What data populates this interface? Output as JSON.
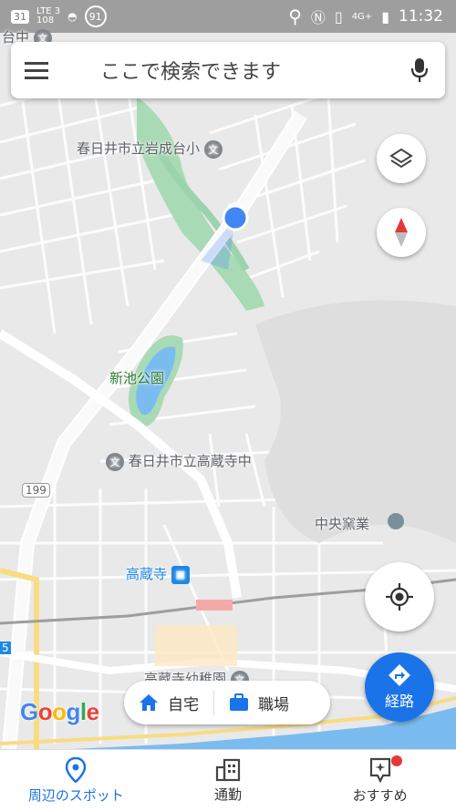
{
  "status_bar": {
    "calendar_day": "31",
    "network": "LTE 3",
    "network_sub": "108",
    "circle_badge": "91",
    "signal": "4G+",
    "time": "11:32"
  },
  "search": {
    "placeholder": "ここで検索できます"
  },
  "map": {
    "labels": {
      "top_fragment": "台中",
      "school_iwanari": "春日井市立岩成台小",
      "park": "新池公園",
      "school_kozoji": "春日井市立高蔵寺中",
      "route_number": "199",
      "company": "中央窯業",
      "station": "高蔵寺",
      "kindergarten": "高蔵寺幼稚園",
      "left_fragment": "5"
    },
    "school_icon_glyph": "文"
  },
  "chips": {
    "home": "自宅",
    "work": "職場"
  },
  "directions_label": "経路",
  "google_logo": {
    "letters": [
      "G",
      "o",
      "o",
      "g",
      "l",
      "e"
    ],
    "colors": [
      "#4285f4",
      "#ea4335",
      "#fbbc05",
      "#4285f4",
      "#34a853",
      "#ea4335"
    ]
  },
  "bottom_nav": {
    "items": [
      "周辺のスポット",
      "通勤",
      "おすすめ"
    ],
    "active_index": 0
  },
  "colors": {
    "accent": "#1a73e8",
    "park_green": "#a8dab5",
    "water": "#7bbcf0",
    "road_yellow": "#f8dc82",
    "notification_red": "#e53935"
  }
}
